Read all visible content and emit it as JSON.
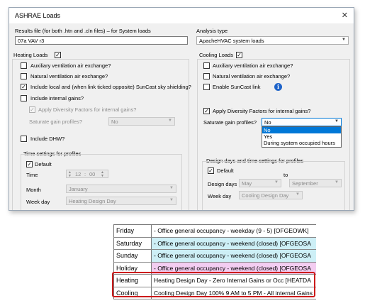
{
  "window": {
    "title": "ASHRAE Loads",
    "close_glyph": "✕"
  },
  "results_file": {
    "label": "Results file  (for both .htn and .cln files) – for System loads",
    "value": "07a VAV r3"
  },
  "analysis_type": {
    "label": "Analysis type",
    "value": "ApacheHVAC system loads"
  },
  "heating": {
    "title": "Heating Loads",
    "checked": true,
    "options": [
      {
        "label": "Auxiliary ventilation air exchange?",
        "checked": false,
        "enabled": true
      },
      {
        "label": "Natural ventilation air exchange?",
        "checked": false,
        "enabled": true
      },
      {
        "label": "Include local and (when link ticked opposite) SunCast sky shielding?",
        "checked": true,
        "enabled": true
      },
      {
        "label": "Include internal gains?",
        "checked": false,
        "enabled": true
      }
    ],
    "diversity": {
      "label": "Apply Diversity Factors for internal gains?",
      "checked": true,
      "enabled": false
    },
    "saturate": {
      "label": "Saturate gain profiles?",
      "value": "No"
    },
    "dhw": {
      "label": "Include DHW?",
      "checked": false
    },
    "time_settings": {
      "title": "Time settings for profiles",
      "default_label": "Default",
      "default_checked": true,
      "time_label": "Time",
      "time_hour": "12",
      "time_sep": ":",
      "time_min": "00",
      "month_label": "Month",
      "month_value": "January",
      "weekday_label": "Week day",
      "weekday_value": "Heating Design Day"
    }
  },
  "cooling": {
    "title": "Cooling Loads",
    "checked": true,
    "options": [
      {
        "label": "Auxiliary ventilation air exchange?",
        "checked": false
      },
      {
        "label": "Natural ventilation air exchange?",
        "checked": false
      },
      {
        "label": "Enable SunCast link",
        "checked": false
      }
    ],
    "info_glyph": "i",
    "diversity": {
      "label": "Apply Diversity Factors for internal gains?",
      "checked": true
    },
    "saturate": {
      "label": "Saturate gain profiles?",
      "value": "No",
      "options": [
        "No",
        "Yes",
        "During system occupied hours"
      ],
      "selected_index": 0
    },
    "design_days": {
      "title": "Design days and time settings for profiles",
      "default_label": "Default",
      "default_checked": true,
      "design_days_label": "Design days",
      "from_value": "May",
      "to_label": "to",
      "to_value": "September",
      "weekday_label": "Week day",
      "weekday_value": "Cooling Design Day"
    }
  },
  "profiles_table": {
    "rows": [
      {
        "day": "Friday",
        "desc": "- Office general occupancy - weekday (9 - 5) [OFGEOWK]",
        "bg": "#ffffff"
      },
      {
        "day": "Saturday",
        "desc": "- Office general occupancy - weekend (closed) [OFGEOSA",
        "bg": "#cdeff6"
      },
      {
        "day": "Sunday",
        "desc": "- Office general occupancy - weekend (closed) [OFGEOSA",
        "bg": "#cdeff6"
      },
      {
        "day": "Holiday",
        "desc": "- Office general occupancy - weekend (closed) [OFGEOSA",
        "bg": "#f3cdf1"
      },
      {
        "day": "Heating",
        "desc": "Heating Design Day - Zero Internal Gains or Occ [HEATDA",
        "bg": "#ffffff"
      },
      {
        "day": "Cooling",
        "desc": "Cooling Design Day 100% 9 AM to 5 PM - All internal Gains",
        "bg": "#ffffff"
      }
    ],
    "highlight_color": "#cc1a1a"
  }
}
